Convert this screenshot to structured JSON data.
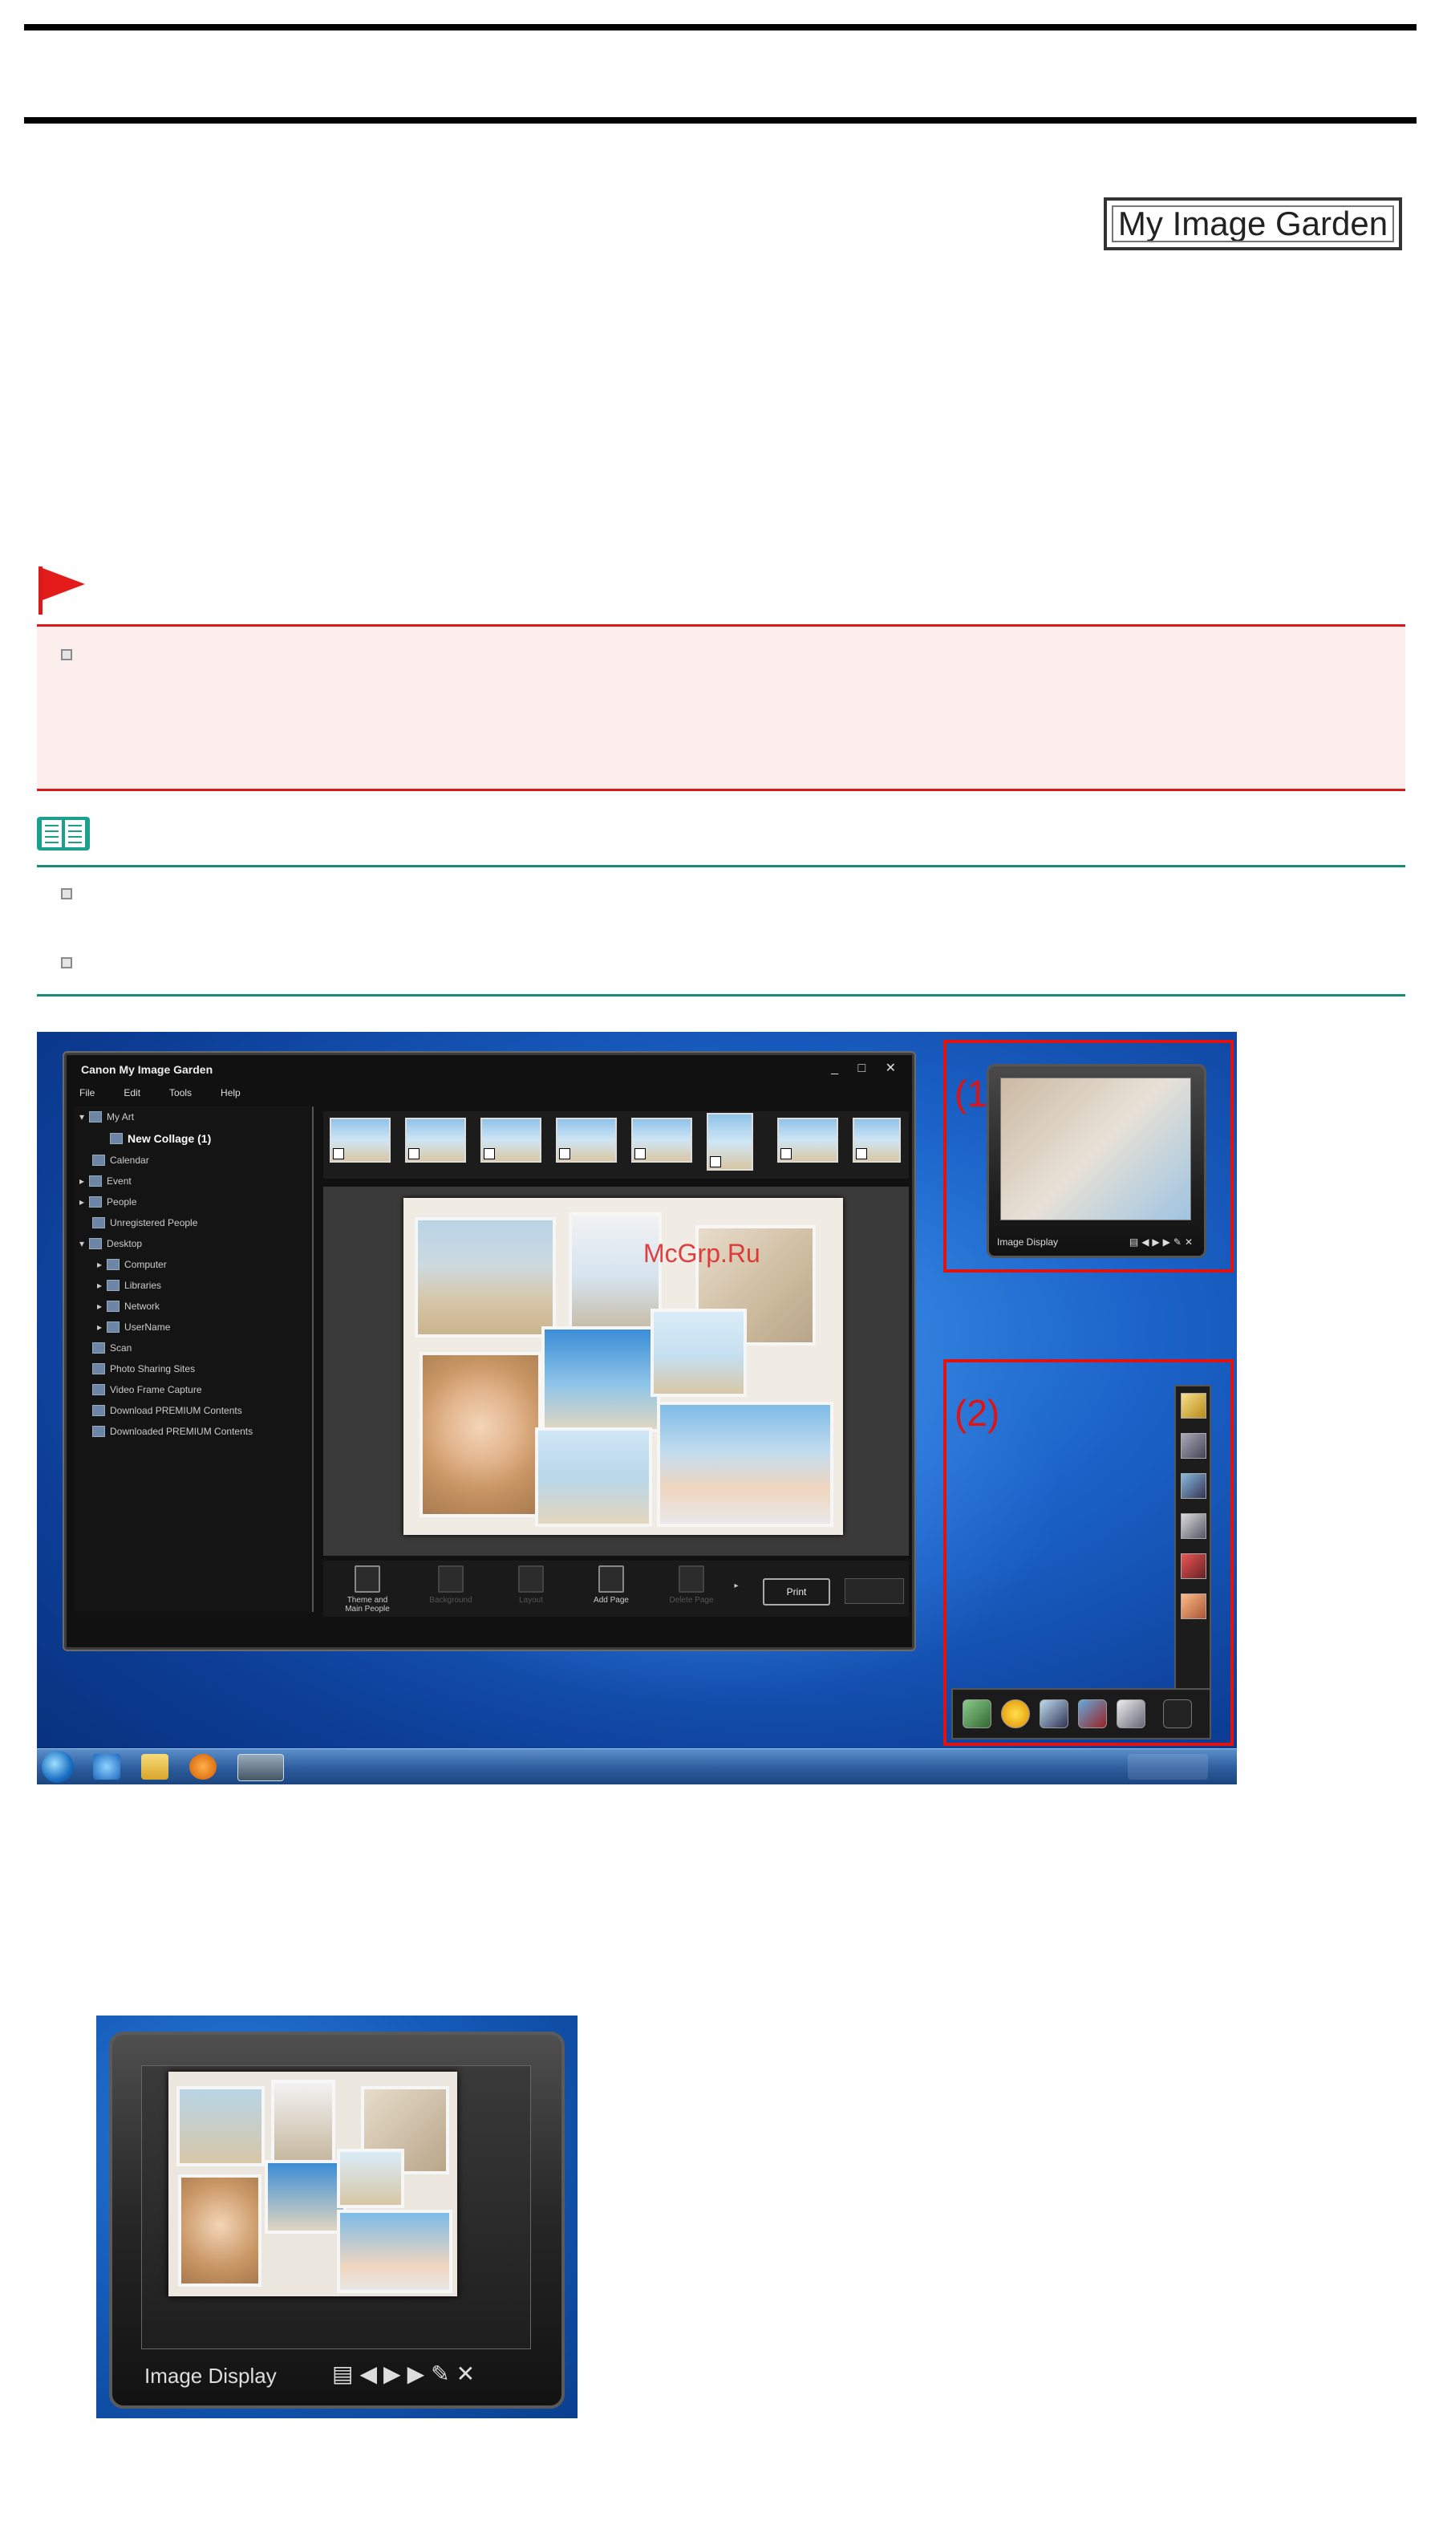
{
  "header": {
    "brand_box_text": "My Image Garden"
  },
  "screenshot": {
    "window_title": "Canon My Image Garden",
    "window_controls": "_ □ ✕",
    "menu": [
      "File",
      "Edit",
      "Tools",
      "Help"
    ],
    "tree": [
      "My Art",
      "New Collage (1)",
      "Calendar",
      "Event",
      "People",
      "Unregistered People",
      "Desktop",
      "Computer",
      "Libraries",
      "Network",
      "UserName",
      "Scan",
      "Photo Sharing Sites",
      "Video Frame Capture",
      "Download PREMIUM Contents",
      "Downloaded PREMIUM Contents"
    ],
    "toolbar": {
      "theme": "Theme and Main People",
      "background": "Background",
      "layout": "Layout",
      "add_page": "Add Page",
      "delete_page": "Delete Page",
      "print": "Print"
    },
    "callout_1": "(1)",
    "callout_2": "(2)",
    "gadget_caption": "Image Display",
    "watermark": "McGrp.Ru"
  },
  "zoom": {
    "gadget_caption": "Image Display"
  },
  "colors": {
    "important_border": "#d71a1a",
    "important_bg": "#fdeeee",
    "note_border": "#1a8a7a",
    "callout_red": "#e01212"
  }
}
